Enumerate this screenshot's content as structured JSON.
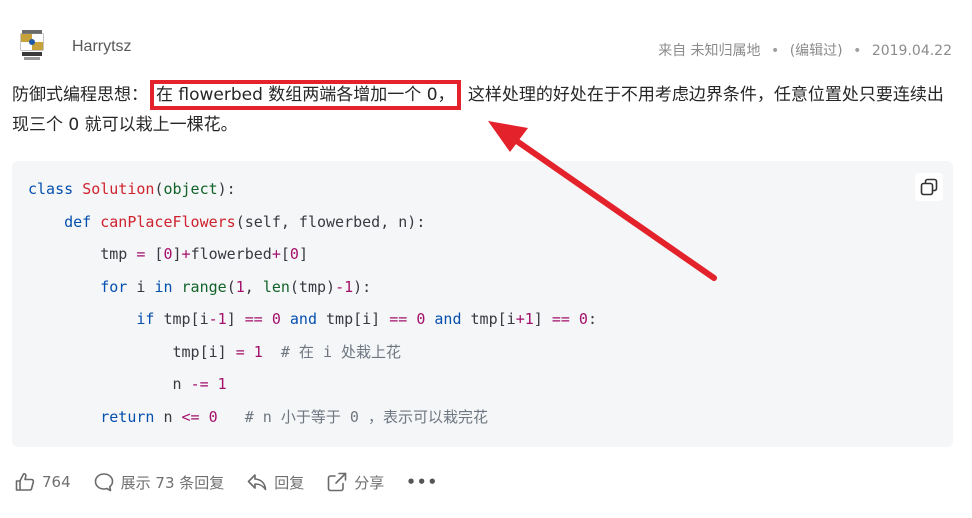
{
  "header": {
    "author": "Harrytsz",
    "source": "来自 未知归属地",
    "edited": "(编辑过)",
    "date": "2019.04.22",
    "dot": "•"
  },
  "body": {
    "prefix": "防御式编程思想：",
    "highlight": "在 flowerbed 数组两端各增加一个 0，",
    "suffix": " 这样处理的好处在于不用考虑边界条件，任意位置处只要连续出现三个 0 就可以栽上一棵花。"
  },
  "code": {
    "lines": [
      "class Solution(object):",
      "    def canPlaceFlowers(self, flowerbed, n):",
      "        tmp = [0]+flowerbed+[0]",
      "        for i in range(1, len(tmp)-1):",
      "            if tmp[i-1] == 0 and tmp[i] == 0 and tmp[i+1] == 0:",
      "                tmp[i] = 1  # 在 i 处栽上花",
      "                n -= 1",
      "        return n <= 0   # n 小于等于 0 ，表示可以栽完花"
    ]
  },
  "actions": {
    "likes": "764",
    "replies": "展示 73 条回复",
    "reply": "回复",
    "share": "分享",
    "more": "•••"
  },
  "annotation": {
    "color": "#e4222b"
  }
}
